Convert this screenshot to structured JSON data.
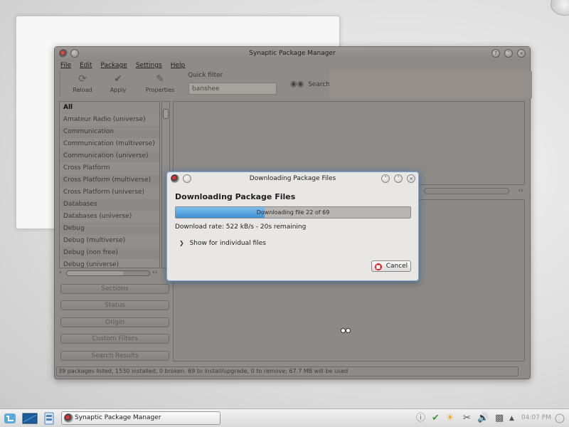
{
  "main_window": {
    "title": "Synaptic Package Manager",
    "menu": [
      "File",
      "Edit",
      "Package",
      "Settings",
      "Help"
    ],
    "toolbar": {
      "reload": "Reload",
      "apply": "Apply",
      "properties": "Properties",
      "quick_filter_label": "Quick filter",
      "quick_filter_value": "banshee",
      "search": "Search"
    },
    "sections": [
      "All",
      "Amateur Radio (universe)",
      "Communication",
      "Communication (multiverse)",
      "Communication (universe)",
      "Cross Platform",
      "Cross Platform (multiverse)",
      "Cross Platform (universe)",
      "Databases",
      "Databases (universe)",
      "Debug",
      "Debug (multiverse)",
      "Debug (non free)",
      "Debug (universe)"
    ],
    "side_buttons": {
      "sections": "Sections",
      "status": "Status",
      "origin": "Origin",
      "custom_filters": "Custom Filters",
      "search_results": "Search Results"
    },
    "status_text": "39 packages listed, 1530 installed, 0 broken. 69 to install/upgrade, 0 to remove; 67.7 MB will be used"
  },
  "dialog": {
    "title": "Downloading Package Files",
    "heading": "Downloading Package Files",
    "progress_text": "Downloading file 22 of 69",
    "progress_fraction": 0.38,
    "rate_text": "Download rate: 522 kB/s - 20s remaining",
    "expander_label": "Show for individual files",
    "cancel_label": "Cancel"
  },
  "taskbar": {
    "task_label": "Synaptic Package Manager",
    "clock": "04:07 PM"
  },
  "colors": {
    "progress_fill": "#3f8fd2",
    "dialog_glow": "#7aa7cf",
    "cancel_icon": "#d42020"
  },
  "icons": {
    "reload": "reload-icon",
    "apply": "apply-check-icon",
    "properties": "properties-pen-icon",
    "search": "binoculars-icon",
    "cancel": "cancel-stop-icon"
  }
}
